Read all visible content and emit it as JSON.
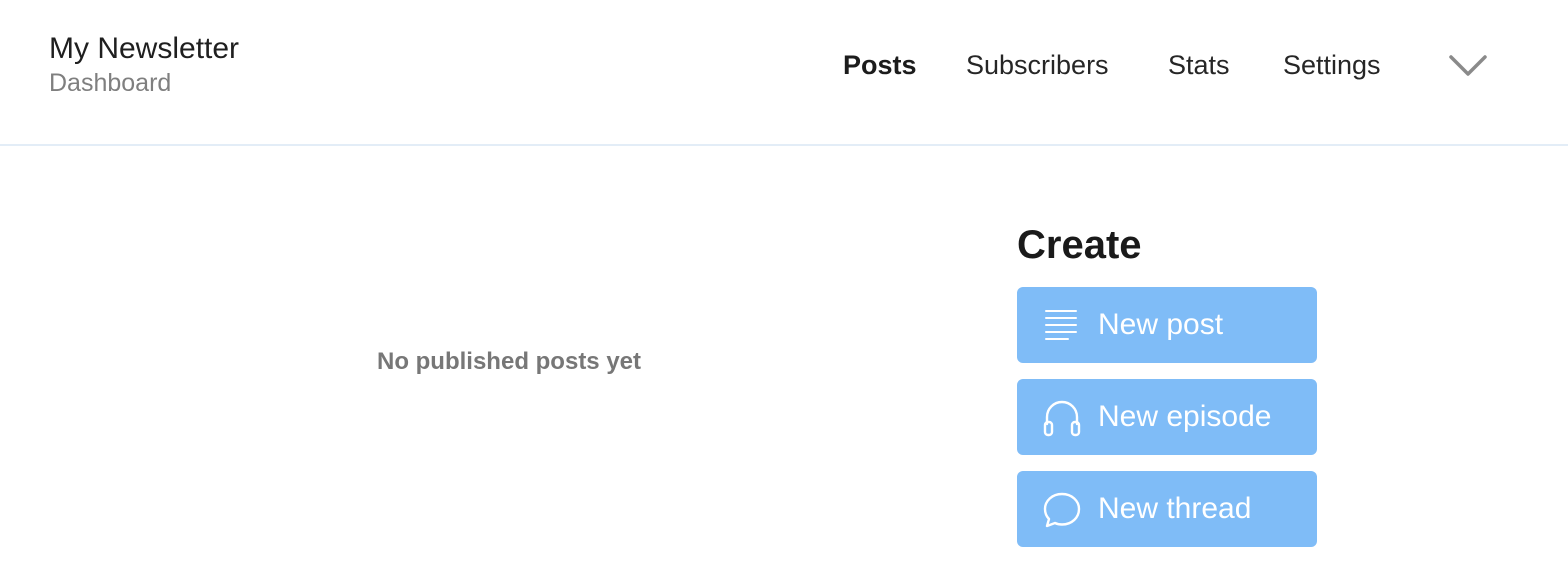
{
  "header": {
    "title": "My Newsletter",
    "subtitle": "Dashboard",
    "nav": [
      {
        "label": "Posts",
        "active": true
      },
      {
        "label": "Subscribers",
        "active": false
      },
      {
        "label": "Stats",
        "active": false
      },
      {
        "label": "Settings",
        "active": false
      }
    ],
    "more_icon": "chevron-down-icon"
  },
  "main": {
    "empty_message": "No published posts yet"
  },
  "create": {
    "title": "Create",
    "buttons": [
      {
        "label": "New post",
        "icon": "lines-icon"
      },
      {
        "label": "New episode",
        "icon": "headphones-icon"
      },
      {
        "label": "New thread",
        "icon": "speech-bubble-icon"
      }
    ]
  },
  "colors": {
    "button_bg": "#7fbcf7",
    "header_border": "#e3edf7",
    "muted_text": "#777777"
  }
}
